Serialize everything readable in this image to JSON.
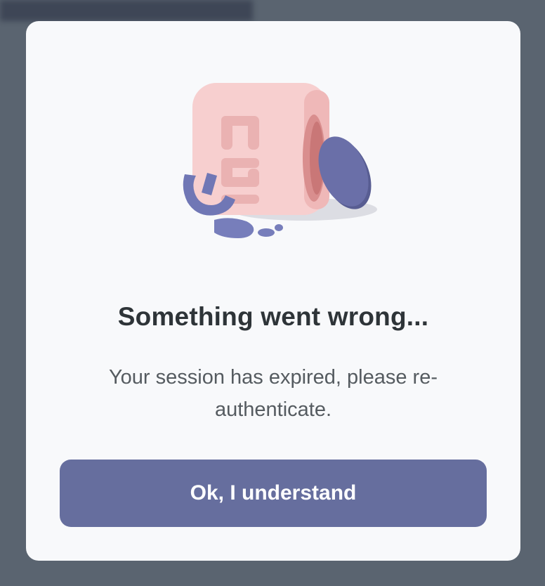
{
  "dialog": {
    "title": "Something went wrong...",
    "message": "Your session has expired, please re-authenticate.",
    "button_label": "Ok, I understand",
    "illustration": {
      "icon": "broken-cube-illustration",
      "colors": {
        "cube": "#f7cfcf",
        "cube_shadow": "#e9a9a9",
        "letters": "#7077b5",
        "disc": "#656aa3"
      }
    }
  },
  "colors": {
    "backdrop": "#5a6470",
    "modal_bg": "#f8f9fb",
    "title": "#2e3438",
    "message": "#555b60",
    "button_bg": "#666e9e",
    "button_text": "#ffffff"
  }
}
